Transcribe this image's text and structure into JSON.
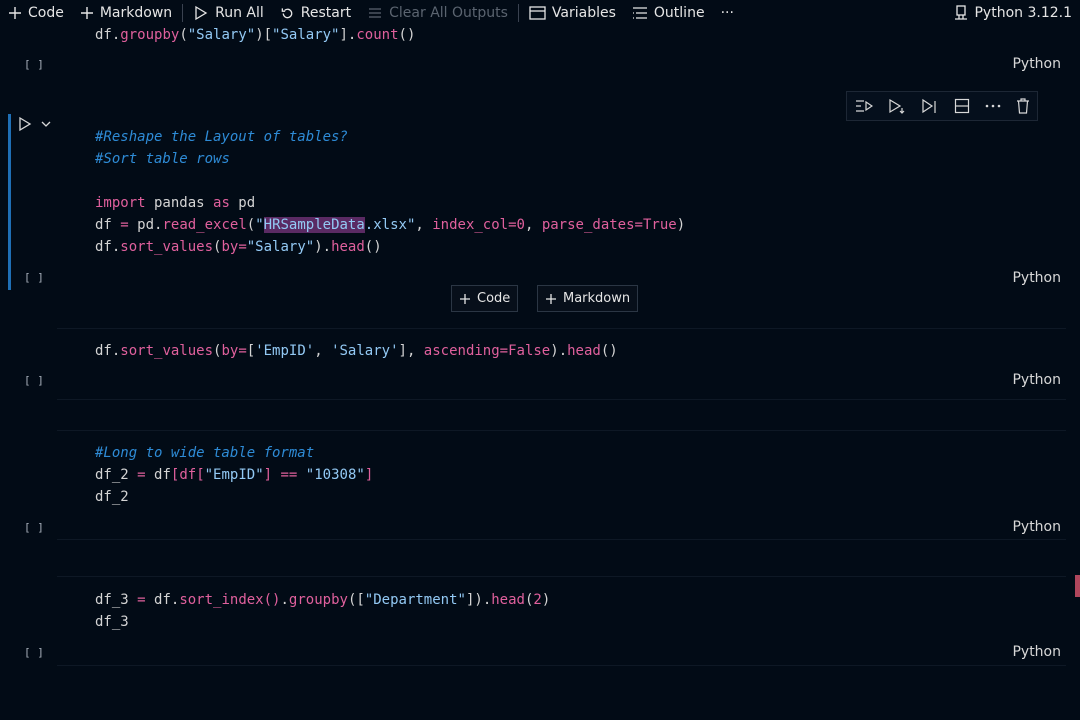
{
  "toolbar": {
    "code_label": "Code",
    "markdown_label": "Markdown",
    "run_all_label": "Run All",
    "restart_label": "Restart",
    "clear_outputs_label": "Clear All Outputs",
    "variables_label": "Variables",
    "outline_label": "Outline",
    "more_label": "···",
    "kernel_label": "Python 3.12.1"
  },
  "cells": {
    "c0": {
      "line1": [
        "df",
        ".",
        "groupby",
        "(",
        "\"Salary\"",
        ")[",
        "\"Salary\"",
        "]",
        ".",
        "count",
        "()"
      ],
      "lang": "Python",
      "bracket": "[ ]"
    },
    "c1": {
      "comment1": "#Reshape the Layout of tables?",
      "comment2": "#Sort table rows",
      "import_kw": "import",
      "import_mod": " pandas ",
      "as_kw": "as",
      "alias": " pd",
      "l4_a": "df ",
      "l4_eq": "=",
      "l4_b": " pd",
      "l4_dot": ".",
      "l4_fn": "read_excel",
      "l4_p": "(",
      "l4_q": "\"",
      "l4_sel": "HRSampleData",
      "l4_rest": ".xlsx\"",
      "l4_c": ", ",
      "l4_arg1": "index_col",
      "l4_eq2": "=",
      "l4_n": "0",
      "l4_c2": ", ",
      "l4_arg2": "parse_dates",
      "l4_eq3": "=",
      "l4_true": "True",
      "l4_end": ")",
      "l5_a": "df",
      "l5_dot": ".",
      "l5_fn": "sort_values",
      "l5_p": "(",
      "l5_arg": "by",
      "l5_eq": "=",
      "l5_str": "\"Salary\"",
      "l5_p2": ")",
      "l5_dot2": ".",
      "l5_fn2": "head",
      "l5_end": "()",
      "lang": "Python",
      "bracket": "[ ]"
    },
    "add_code_label": "Code",
    "add_markdown_label": "Markdown",
    "c2": {
      "a": "df",
      "dot": ".",
      "fn": "sort_values",
      "p": "(",
      "arg": "by",
      "eq": "=",
      "lb": "[",
      "s1": "'EmpID'",
      "c": ", ",
      "s2": "'Salary'",
      "rb": "]",
      "c2": ", ",
      "arg2": "ascending",
      "eq2": "=",
      "f": "False",
      "p2": ")",
      "dot2": ".",
      "fn2": "head",
      "end": "()",
      "lang": "Python",
      "bracket": "[ ]"
    },
    "c3": {
      "comment": "#Long to wide table format",
      "l2_a": "df_2 ",
      "l2_eq": "=",
      "l2_b": " df",
      "l2_lb": "[",
      "l2_c": "df",
      "l2_lb2": "[",
      "l2_s": "\"EmpID\"",
      "l2_rb": "]",
      "l2_op": " == ",
      "l2_s2": "\"10308\"",
      "l2_end": "]",
      "l3": "df_2",
      "lang": "Python",
      "bracket": "[ ]"
    },
    "c4": {
      "l1_a": "df_3 ",
      "l1_eq": "=",
      "l1_b": " df",
      "l1_dot": ".",
      "l1_fn": "sort_index",
      "l1_p": "()",
      "l1_dot2": ".",
      "l1_fn2": "groupby",
      "l1_p2": "([",
      "l1_s": "\"Department\"",
      "l1_p3": "])",
      "l1_dot3": ".",
      "l1_fn3": "head",
      "l1_p4": "(",
      "l1_n": "2",
      "l1_end": ")",
      "l2": "df_3",
      "lang": "Python",
      "bracket": "[ ]"
    }
  },
  "colors": {
    "background": "#020b16",
    "comment": "#2e8bd6",
    "function": "#e0609d",
    "string": "#93c9f4",
    "active_bar": "#1f6fb5",
    "selection": "#5a2a63"
  }
}
